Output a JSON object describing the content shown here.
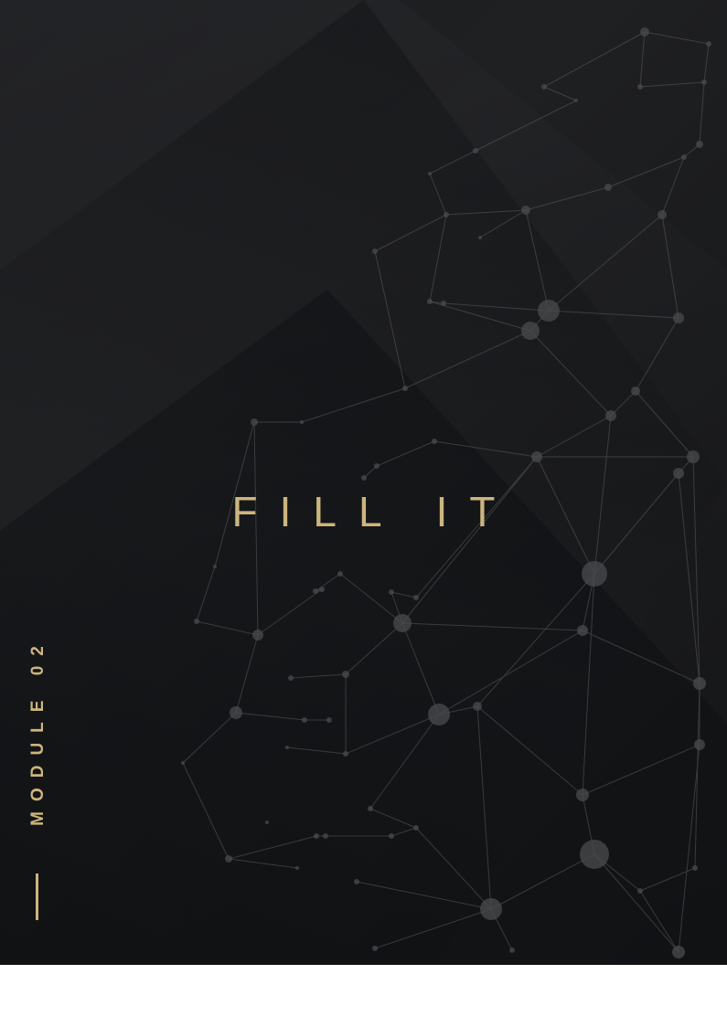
{
  "cover": {
    "title": "FILL IT",
    "module_label": "MODULE 02",
    "accent_color": "#cdb57e",
    "background_color": "#18191b",
    "decoration": "network-globe"
  }
}
